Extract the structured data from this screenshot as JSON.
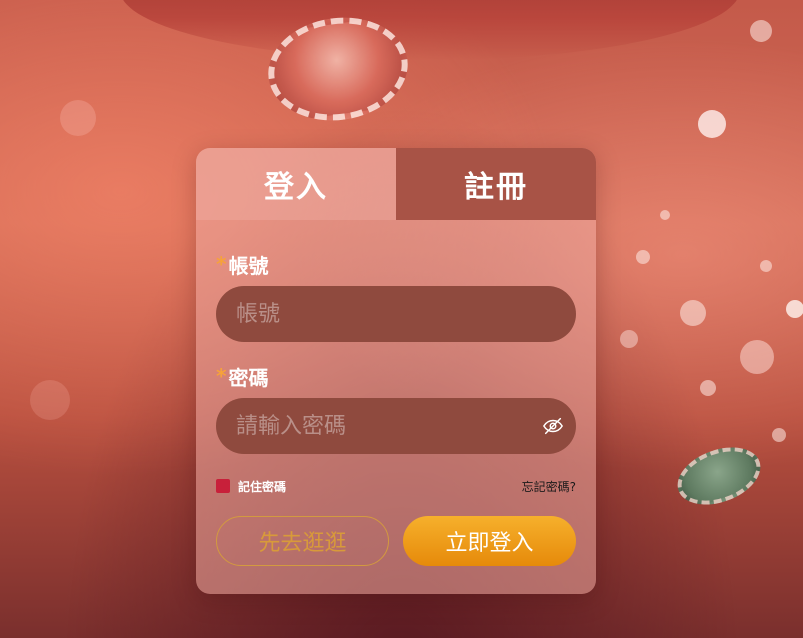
{
  "colors": {
    "accent": "#f6a23a",
    "login_button": "#eea01a",
    "checkbox": "#c8203a",
    "inactive_tab": "#a85346",
    "input_bg": "#8f4a3e"
  },
  "tabs": [
    {
      "label": "登入",
      "active": true
    },
    {
      "label": "註冊",
      "active": false
    }
  ],
  "form": {
    "account": {
      "required_mark": "*",
      "label": "帳號",
      "placeholder": "帳號",
      "value": ""
    },
    "password": {
      "required_mark": "*",
      "label": "密碼",
      "placeholder": "請輸入密碼",
      "value": "",
      "toggle_icon": "eye-slash-icon"
    },
    "remember_label": "記住密碼",
    "forgot_label": "忘記密碼?"
  },
  "buttons": {
    "guest_label": "先去逛逛",
    "login_label": "立即登入"
  }
}
